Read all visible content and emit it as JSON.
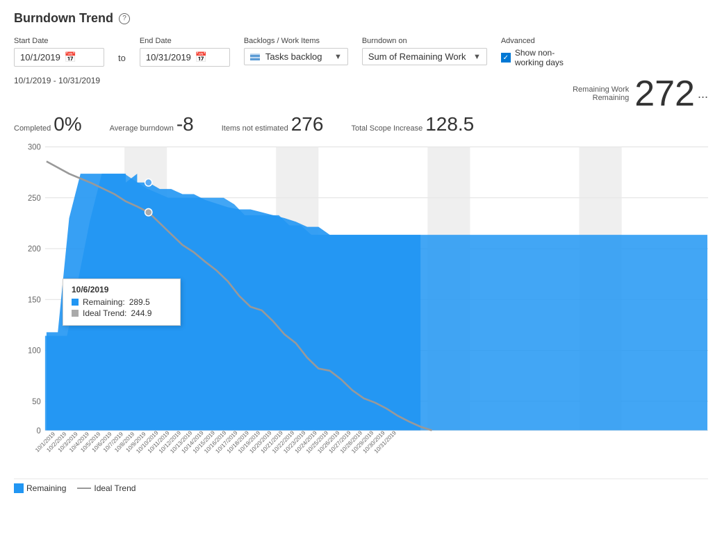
{
  "title": "Burndown Trend",
  "help_icon": "?",
  "controls": {
    "start_date_label": "Start Date",
    "start_date_value": "10/1/2019",
    "to_label": "to",
    "end_date_label": "End Date",
    "end_date_value": "10/31/2019",
    "backlogs_label": "Backlogs / Work Items",
    "backlogs_value": "Tasks backlog",
    "burndown_label": "Burndown on",
    "burndown_value": "Sum of Remaining Work",
    "advanced_label": "Advanced",
    "show_nonworking_label": "Show non-working days",
    "show_nonworking_checked": true
  },
  "date_range": "10/1/2019 - 10/31/2019",
  "more_icon": "...",
  "stats": {
    "completed_label": "Completed",
    "completed_value": "0%",
    "avg_burndown_label": "Average burndown",
    "avg_burndown_value": "-8",
    "items_label": "Items not estimated",
    "items_value": "276",
    "scope_label": "Total Scope Increase",
    "scope_value": "128.5"
  },
  "remaining": {
    "label": "Remaining Work",
    "sublabel": "Remaining",
    "value": "272"
  },
  "chart": {
    "y_ticks": [
      "300",
      "250",
      "200",
      "150",
      "100",
      "50",
      "0"
    ],
    "x_ticks": [
      "10/1/2019",
      "10/2/2019",
      "10/3/2019",
      "10/4/2019",
      "10/5/2019",
      "10/6/2019",
      "10/7/2019",
      "10/8/2019",
      "10/9/2019",
      "10/10/2019",
      "10/11/2019",
      "10/12/2019",
      "10/13/2019",
      "10/14/2019",
      "10/15/2019",
      "10/16/2019",
      "10/17/2019",
      "10/18/2019",
      "10/19/2019",
      "10/20/2019",
      "10/21/2019",
      "10/22/2019",
      "10/23/2019",
      "10/24/2019",
      "10/25/2019",
      "10/26/2019",
      "10/27/2019",
      "10/28/2019",
      "10/29/2019",
      "10/30/2019",
      "10/31/2019"
    ]
  },
  "tooltip": {
    "date": "10/6/2019",
    "remaining_label": "Remaining:",
    "remaining_value": "289.5",
    "ideal_label": "Ideal Trend:",
    "ideal_value": "244.9"
  },
  "legend": {
    "remaining_label": "Remaining",
    "ideal_label": "Ideal Trend"
  }
}
